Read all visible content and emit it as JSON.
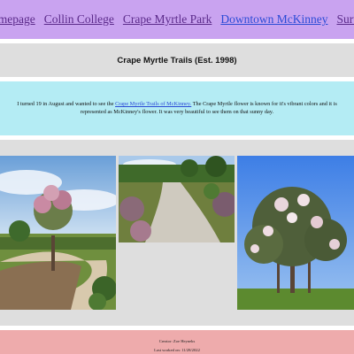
{
  "nav": {
    "items": [
      {
        "label": "Homepage",
        "state": "visited"
      },
      {
        "label": "Collin College",
        "state": "visited"
      },
      {
        "label": "Crape Myrtle Park",
        "state": "visited"
      },
      {
        "label": "Downtown McKinney",
        "state": "link"
      },
      {
        "label": "Survey",
        "state": "visited"
      }
    ]
  },
  "header": {
    "title": "Crape Myrtle Trails (Est. 1998)"
  },
  "intro": {
    "text_before": "I turned 19 in August and wanted to see the ",
    "link_text": "Crape Myrtle Trails of McKinney.",
    "text_after": " The Crape Myrtle flower is known for it's vibrant colors and it is represented as McKinney's flower. It was very beautiful to see them on that sunny day."
  },
  "gallery": {
    "photos": [
      {
        "subject": "crape-myrtle-tree-with-curving-path"
      },
      {
        "subject": "concrete-trail-through-shrubs"
      },
      {
        "subject": "blooming-crape-myrtle-tree-blue-sky"
      }
    ]
  },
  "footer": {
    "creator": "Creator: Zoe Heyneks",
    "last_worked": "Last worked on: 11/28/2022"
  },
  "colors": {
    "nav_bg": "#c9a3f0",
    "title_bg": "#dedede",
    "intro_bg": "#b4ecf4",
    "gallery_bg": "#dedede",
    "footer_bg": "#eeabac",
    "link": "#2b4bd6",
    "visited_link": "#5b2a8a"
  }
}
